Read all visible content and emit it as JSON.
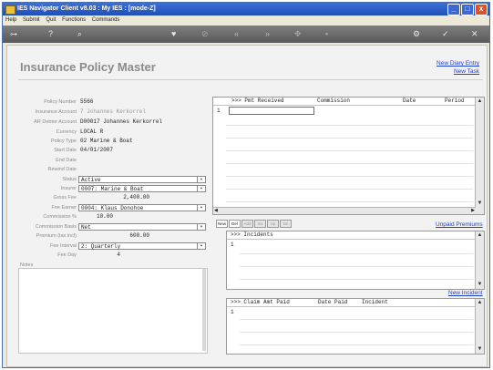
{
  "window": {
    "title": "IES Navigator Client v8.03 : My IES :     [mode-Z]",
    "controls": [
      "_",
      "□",
      "x"
    ]
  },
  "menu": [
    "Help",
    "Submit",
    "Quit",
    "Functions",
    "Commands"
  ],
  "toolbar": {
    "left": [
      "key-icon",
      "help-icon",
      "search-icon"
    ],
    "right": [
      "favorite-icon",
      "history-icon",
      "back-icon",
      "forward-icon",
      "new-icon",
      "save-icon",
      "settings-icon",
      "ok-icon",
      "close-icon"
    ]
  },
  "page": {
    "title": "Insurance Policy Master",
    "links": {
      "new_diary": "New Diary Entry",
      "new_task": "New Task"
    }
  },
  "form": {
    "policy_number": {
      "label": "Policy Number",
      "value": "5566"
    },
    "insurance_account": {
      "label": "Insurance Account",
      "value": "7 Johannes Kerkorrel"
    },
    "ar_debtor_account": {
      "label": "AR Debtor Account",
      "value": "D00017 Johannes Kerkorrel"
    },
    "currency": {
      "label": "Currency",
      "value": "LOCAL R"
    },
    "policy_type": {
      "label": "Policy Type",
      "value": "02 Marine & Boat"
    },
    "start_date": {
      "label": "Start Date",
      "value": "04/01/2007"
    },
    "end_date": {
      "label": "End Date",
      "value": ""
    },
    "rewind_date": {
      "label": "Rewind Date",
      "value": ""
    },
    "status": {
      "label": "Status",
      "value": "Active"
    },
    "insurer": {
      "label": "Insurer",
      "value": "0007: Marine & Boat"
    },
    "gross_fee": {
      "label": "Gross Fee",
      "value": "2,400.00"
    },
    "fee_earner": {
      "label": "Fee Earner",
      "value": "0004: Klaus Donohoe"
    },
    "commission_pct": {
      "label": "Commission %",
      "value": "10.00"
    },
    "commission_basis": {
      "label": "Commission Basis",
      "value": "Net"
    },
    "premium": {
      "label": "Premium (tax incl)",
      "value": "600.00"
    },
    "fee_interval": {
      "label": "Fee Interval",
      "value": "2: Quarterly"
    },
    "fee_day": {
      "label": "Fee Day",
      "value": "4"
    },
    "notes": {
      "label": "Notes",
      "value": ""
    }
  },
  "payments_grid": {
    "columns": [
      ">>> Pmt Received",
      "Commission",
      "Date",
      "Period"
    ],
    "rows": [
      "1"
    ]
  },
  "grid_buttons": [
    "New",
    "Del",
    "Add",
    "Ins",
    "Up",
    "Dn"
  ],
  "unpaid_link": "Unpaid Premiums",
  "incidents_grid": {
    "columns": [
      ">>> Incidents"
    ],
    "rows": [
      "1"
    ]
  },
  "new_incident_link": "New Incident",
  "claims_grid": {
    "columns": [
      ">>> Claim Amt Paid",
      "Date Paid",
      "Incident"
    ],
    "rows": [
      "1"
    ]
  }
}
